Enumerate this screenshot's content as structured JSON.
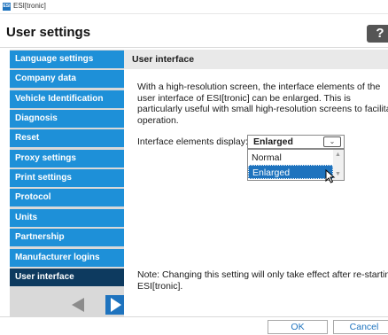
{
  "window": {
    "app_icon_text": "ESI",
    "title": "ESI[tronic]"
  },
  "header": {
    "title": "User settings",
    "help_label": "?"
  },
  "sidebar": {
    "items": [
      {
        "label": "Language settings"
      },
      {
        "label": "Company data"
      },
      {
        "label": "Vehicle Identification"
      },
      {
        "label": "Diagnosis"
      },
      {
        "label": "Reset"
      },
      {
        "label": "Proxy settings"
      },
      {
        "label": "Print settings"
      },
      {
        "label": "Protocol"
      },
      {
        "label": "Units"
      },
      {
        "label": "Partnership"
      },
      {
        "label": "Manufacturer logins"
      },
      {
        "label": "User interface"
      }
    ],
    "active_index": 11
  },
  "main": {
    "section_title": "User interface",
    "description": "With a high-resolution screen, the interface elements of the\nuser interface of ESI[tronic] can be enlarged. This is\nparticularly useful with small high-resolution screens to facilitate\noperation.",
    "display_label": "Interface elements display:",
    "dropdown": {
      "value": "Enlarged",
      "options": [
        "Normal",
        "Enlarged"
      ],
      "highlighted": "Enlarged"
    },
    "note": "Note: Changing this setting will only take effect after re-starting\nESI[tronic]."
  },
  "footer": {
    "ok_label": "OK",
    "cancel_label": "Cancel"
  },
  "colors": {
    "nav_blue": "#1e90d8",
    "nav_active": "#0d3a5f",
    "accent": "#1e73be"
  }
}
